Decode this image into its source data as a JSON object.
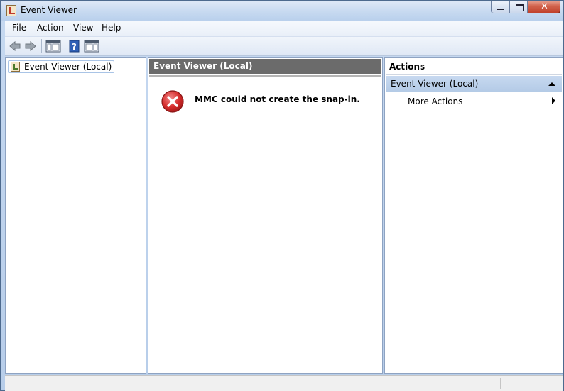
{
  "window": {
    "title": "Event Viewer"
  },
  "menubar": {
    "items": [
      "File",
      "Action",
      "View",
      "Help"
    ]
  },
  "toolbar": {
    "icons": [
      "back-arrow-icon",
      "forward-arrow-icon",
      "show-hide-console-tree-icon",
      "help-icon",
      "show-hide-action-pane-icon"
    ]
  },
  "tree": {
    "root_label": "Event Viewer (Local)"
  },
  "center": {
    "header": "Event Viewer (Local)",
    "error_message": "MMC could not create the snap-in."
  },
  "actions": {
    "header": "Actions",
    "group_label": "Event Viewer (Local)",
    "items": [
      {
        "label": "More Actions"
      }
    ]
  },
  "colors": {
    "error_red": "#d62c2c",
    "center_header_bg": "#6b6b6b",
    "actions_group_bg": "#bcd0ea"
  }
}
